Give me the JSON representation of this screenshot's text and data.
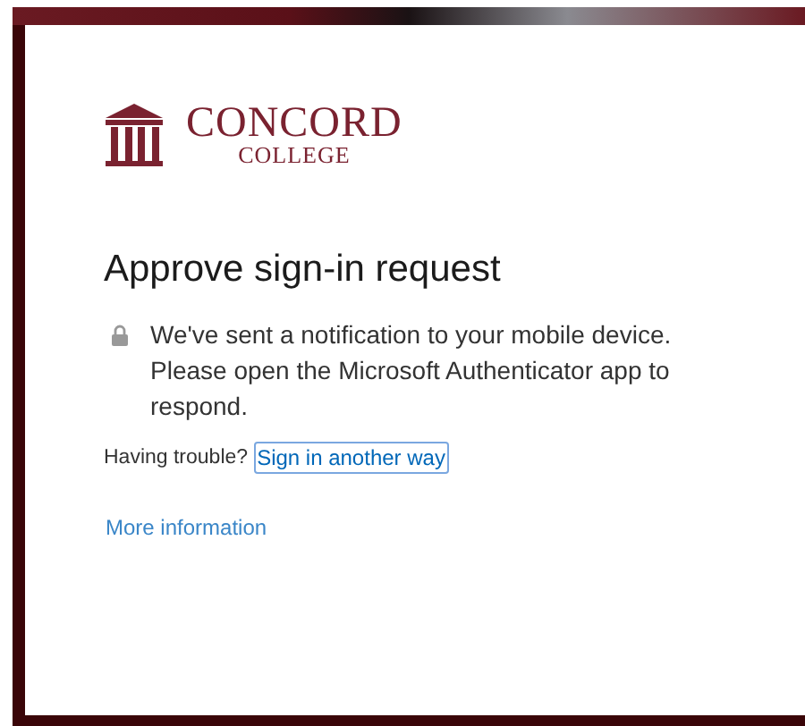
{
  "logo": {
    "name": "CONCORD",
    "subtitle": "COLLEGE"
  },
  "title": "Approve sign-in request",
  "message": "We've sent a notification to your mobile device. Please open the Microsoft Authenticator app to respond.",
  "trouble": {
    "label": "Having trouble?",
    "link": "Sign in another way",
    "focused": true
  },
  "more_link": "More information"
}
